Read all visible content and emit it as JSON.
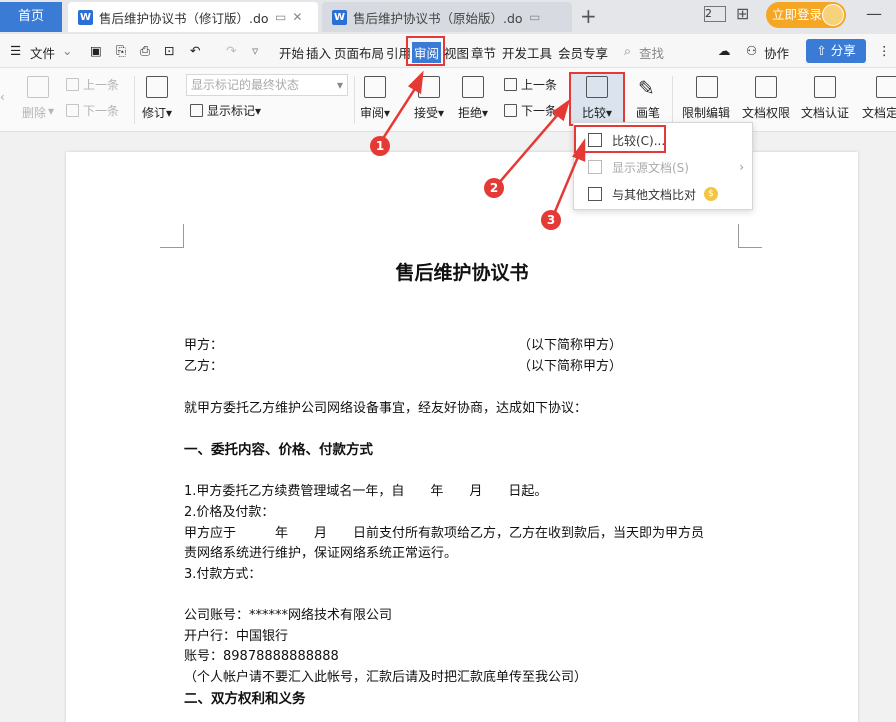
{
  "tabs": {
    "home": "首页",
    "active_doc": "售后维护协议书（修订版）.doc",
    "inactive_doc": "售后维护协议书（原始版）.doc",
    "new_tab": "+",
    "window_count": "2",
    "login": "立即登录"
  },
  "menu": {
    "file": "文件",
    "items": [
      "开始",
      "插入",
      "页面布局",
      "引用",
      "审阅",
      "视图",
      "章节",
      "开发工具",
      "会员专享"
    ],
    "search": "查找",
    "collaborate": "协作",
    "share": "分享"
  },
  "ribbon": {
    "delete": "删除",
    "prev_comment": "上一条",
    "next_comment": "下一条",
    "track_changes": "修订",
    "display_state": "显示标记的最终状态",
    "show_markup": "显示标记",
    "review": "审阅",
    "accept": "接受",
    "reject": "拒绝",
    "prev_change": "上一条",
    "next_change": "下一条",
    "compare": "比较",
    "ink": "画笔",
    "restrict_edit": "限制编辑",
    "doc_rights": "文档权限",
    "doc_cert": "文档认证",
    "doc_final": "文档定"
  },
  "dropdown": {
    "compare": "比较(C)...",
    "show_source": "显示源文档(S)",
    "compare_other": "与其他文档比对"
  },
  "callouts": [
    "1",
    "2",
    "3"
  ],
  "document": {
    "title": "售后维护协议书",
    "party_a": "甲方：",
    "party_a_note": "（以下简称甲方）",
    "party_b": "乙方：",
    "party_b_note": "（以下简称甲方）",
    "intro": "就甲方委托乙方维护公司网络设备事宜，经友好协商，达成如下协议：",
    "section1": "一、委托内容、价格、付款方式",
    "item1": "1.甲方委托乙方续费管理域名一年，自　　年　　月　　日起。",
    "item2": "2.价格及付款：",
    "item2_text1": "甲方应于　　　年　　月　　日前支付所有款项给乙方，乙方在收到款后，当天即为甲方员",
    "item2_text2": "责网络系统进行维护，保证网络系统正常运行。",
    "item3": "3.付款方式：",
    "company": "公司账号：******网络技术有限公司",
    "bank": "开户行：中国银行",
    "account": "账号：89878888888888",
    "notice": "（个人帐户请不要汇入此帐号，汇款后请及时把汇款底单传至我公司）",
    "section2": "二、双方权利和义务"
  },
  "colors": {
    "accent": "#3a7bd5",
    "highlight": "#e53935",
    "login": "#f5a623"
  }
}
